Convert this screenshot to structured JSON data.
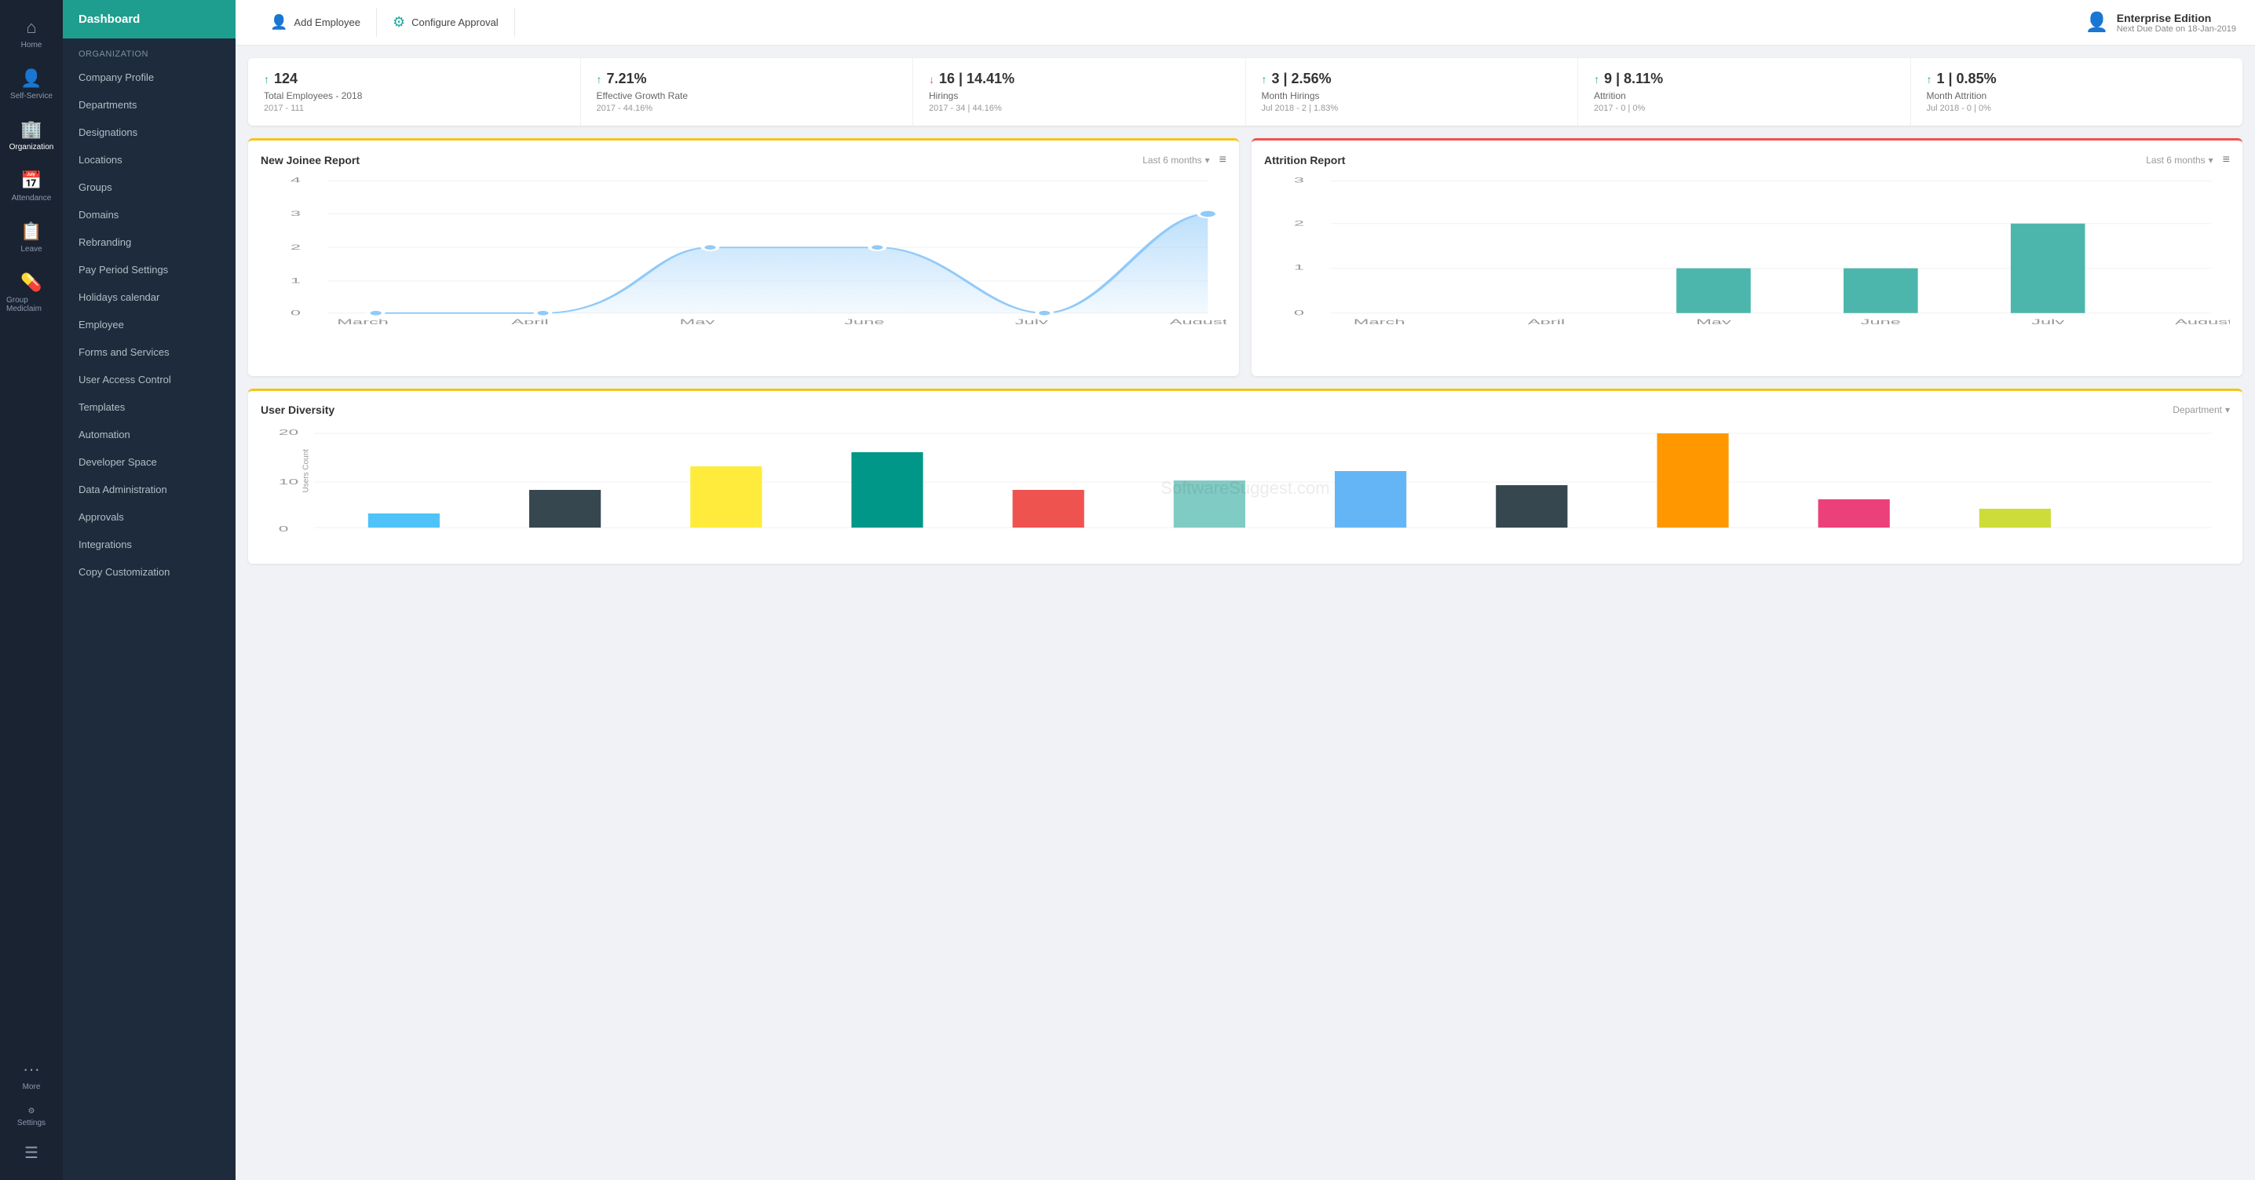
{
  "rail": {
    "items": [
      {
        "id": "home",
        "icon": "⌂",
        "label": "Home"
      },
      {
        "id": "self-service",
        "icon": "👤",
        "label": "Self-Service"
      },
      {
        "id": "organization",
        "icon": "🏢",
        "label": "Organization"
      },
      {
        "id": "attendance",
        "icon": "📅",
        "label": "Attendance"
      },
      {
        "id": "leave",
        "icon": "📋",
        "label": "Leave"
      },
      {
        "id": "group-mediclaim",
        "icon": "💊",
        "label": "Group Mediclaim"
      }
    ],
    "more_label": "More",
    "settings_label": "Settings"
  },
  "sidebar": {
    "active_item": "Dashboard",
    "active_label": "Dashboard",
    "section_label": "Organization",
    "items": [
      {
        "id": "company-profile",
        "label": "Company Profile"
      },
      {
        "id": "departments",
        "label": "Departments"
      },
      {
        "id": "designations",
        "label": "Designations"
      },
      {
        "id": "locations",
        "label": "Locations"
      },
      {
        "id": "groups",
        "label": "Groups"
      },
      {
        "id": "domains",
        "label": "Domains"
      },
      {
        "id": "rebranding",
        "label": "Rebranding"
      },
      {
        "id": "pay-period-settings",
        "label": "Pay Period Settings"
      },
      {
        "id": "holidays-calendar",
        "label": "Holidays calendar"
      },
      {
        "id": "employee",
        "label": "Employee"
      },
      {
        "id": "forms-and-services",
        "label": "Forms and Services"
      },
      {
        "id": "user-access-control",
        "label": "User Access Control"
      },
      {
        "id": "templates",
        "label": "Templates"
      },
      {
        "id": "automation",
        "label": "Automation"
      },
      {
        "id": "developer-space",
        "label": "Developer Space"
      },
      {
        "id": "data-administration",
        "label": "Data Administration"
      },
      {
        "id": "approvals",
        "label": "Approvals"
      },
      {
        "id": "integrations",
        "label": "Integrations"
      },
      {
        "id": "copy-customization",
        "label": "Copy Customization"
      }
    ]
  },
  "topbar": {
    "add_employee_label": "Add Employee",
    "configure_approval_label": "Configure Approval",
    "enterprise_title": "Enterprise Edition",
    "enterprise_due": "Next Due Date on 18-Jan-2019"
  },
  "stats": [
    {
      "id": "total-employees",
      "arrow": "up",
      "value": "124",
      "label": "Total Employees - 2018",
      "prev": "2017 - 111"
    },
    {
      "id": "growth-rate",
      "arrow": "up",
      "value": "7.21%",
      "label": "Effective Growth Rate",
      "prev": "2017 - 44.16%"
    },
    {
      "id": "hirings",
      "arrow": "down",
      "value": "16 | 14.41%",
      "label": "Hirings",
      "prev": "2017 - 34 | 44.16%"
    },
    {
      "id": "month-hirings",
      "arrow": "up",
      "value": "3 | 2.56%",
      "label": "Month Hirings",
      "prev": "Jul 2018 - 2 | 1.83%"
    },
    {
      "id": "attrition",
      "arrow": "up",
      "value": "9 | 8.11%",
      "label": "Attrition",
      "prev": "2017 - 0 | 0%"
    },
    {
      "id": "month-attrition",
      "arrow": "up",
      "value": "1 | 0.85%",
      "label": "Month Attrition",
      "prev": "Jul 2018 - 0 | 0%"
    }
  ],
  "new_joinee_chart": {
    "title": "New Joinee Report",
    "period": "Last 6 months",
    "x_labels": [
      "March",
      "April",
      "May",
      "June",
      "July",
      "August"
    ],
    "y_labels": [
      "0",
      "1",
      "2",
      "3",
      "4"
    ],
    "data": [
      0,
      0,
      2,
      2,
      0,
      3
    ]
  },
  "attrition_chart": {
    "title": "Attrition Report",
    "period": "Last 6 months",
    "x_labels": [
      "March",
      "April",
      "May",
      "June",
      "July",
      "August"
    ],
    "y_labels": [
      "0",
      "1",
      "2",
      "3"
    ],
    "data": [
      0,
      0,
      1,
      1,
      2,
      0
    ]
  },
  "diversity_chart": {
    "title": "User Diversity",
    "filter": "Department",
    "y_max": 20,
    "y_labels": [
      "0",
      "10",
      "20"
    ],
    "watermark": "SoftwareSuggest.com",
    "bars": [
      {
        "color": "#4fc3f7",
        "height": 15
      },
      {
        "color": "#37474f",
        "height": 40
      },
      {
        "color": "#ffeb3b",
        "height": 65
      },
      {
        "color": "#009688",
        "height": 80
      },
      {
        "color": "#ef5350",
        "height": 40
      },
      {
        "color": "#80cbc4",
        "height": 50
      },
      {
        "color": "#64b5f6",
        "height": 60
      },
      {
        "color": "#37474f",
        "height": 45
      },
      {
        "color": "#ff9800",
        "height": 100
      },
      {
        "color": "#ec407a",
        "height": 30
      },
      {
        "color": "#cddc39",
        "height": 20
      }
    ]
  }
}
